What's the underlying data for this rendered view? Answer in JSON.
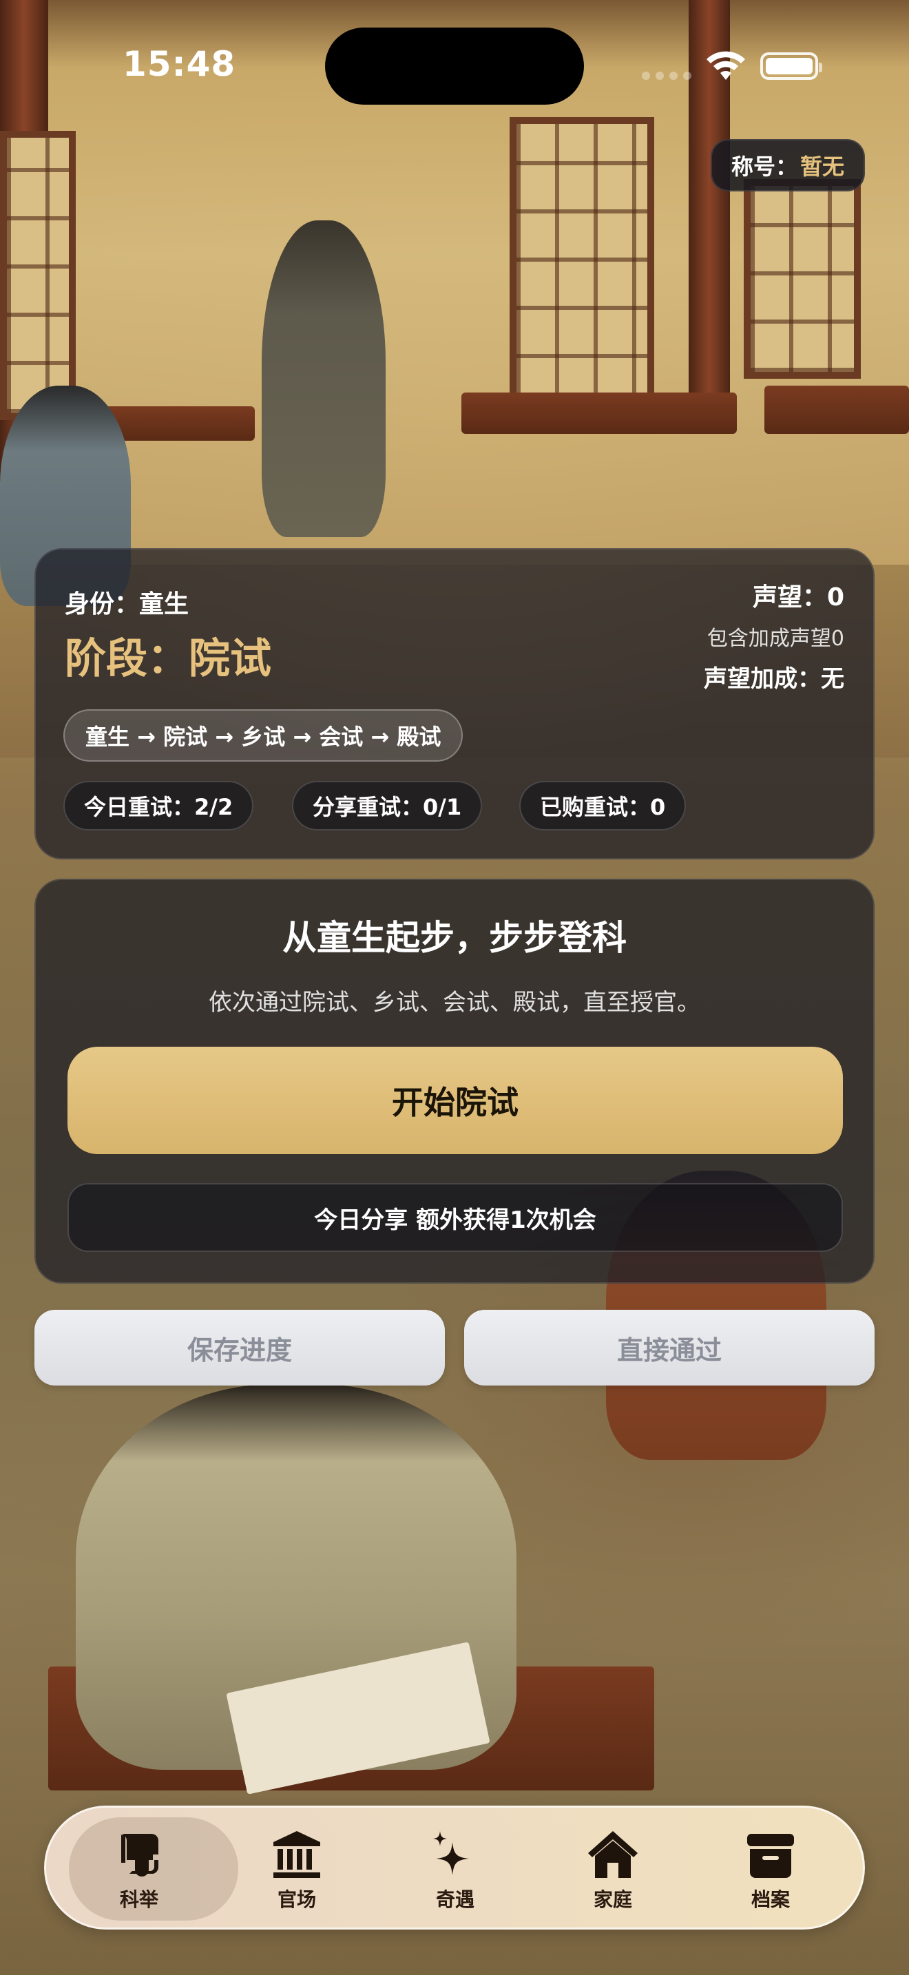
{
  "status_bar": {
    "time": "15:48"
  },
  "title_badge": {
    "label": "称号：",
    "value": "暂无"
  },
  "status": {
    "identity": "身份：童生",
    "stage": "阶段：院试",
    "reputation": "声望：0",
    "reputation_included": "包含加成声望0",
    "reputation_bonus": "声望加成：无",
    "path": "童生 → 院试 → 乡试 → 会试 → 殿试",
    "chips": [
      "今日重试：2/2",
      "分享重试：0/1",
      "已购重试：0"
    ]
  },
  "exam": {
    "title": "从童生起步，步步登科",
    "subtitle": "依次通过院试、乡试、会试、殿试，直至授官。",
    "start_label": "开始院试",
    "share_label": "今日分享 额外获得1次机会"
  },
  "actions": {
    "save_label": "保存进度",
    "pass_label": "直接通过"
  },
  "tabs": [
    {
      "label": "科举",
      "icon": "scroll-icon",
      "active": true
    },
    {
      "label": "官场",
      "icon": "government-building-icon",
      "active": false
    },
    {
      "label": "奇遇",
      "icon": "sparkles-icon",
      "active": false
    },
    {
      "label": "家庭",
      "icon": "home-icon",
      "active": false
    },
    {
      "label": "档案",
      "icon": "archive-box-icon",
      "active": false
    }
  ],
  "colors": {
    "accent_gold": "#e7c27e",
    "button_gold": "#dcb872",
    "card_dark": "#1e1e26",
    "tab_ink": "#2a1a10"
  }
}
